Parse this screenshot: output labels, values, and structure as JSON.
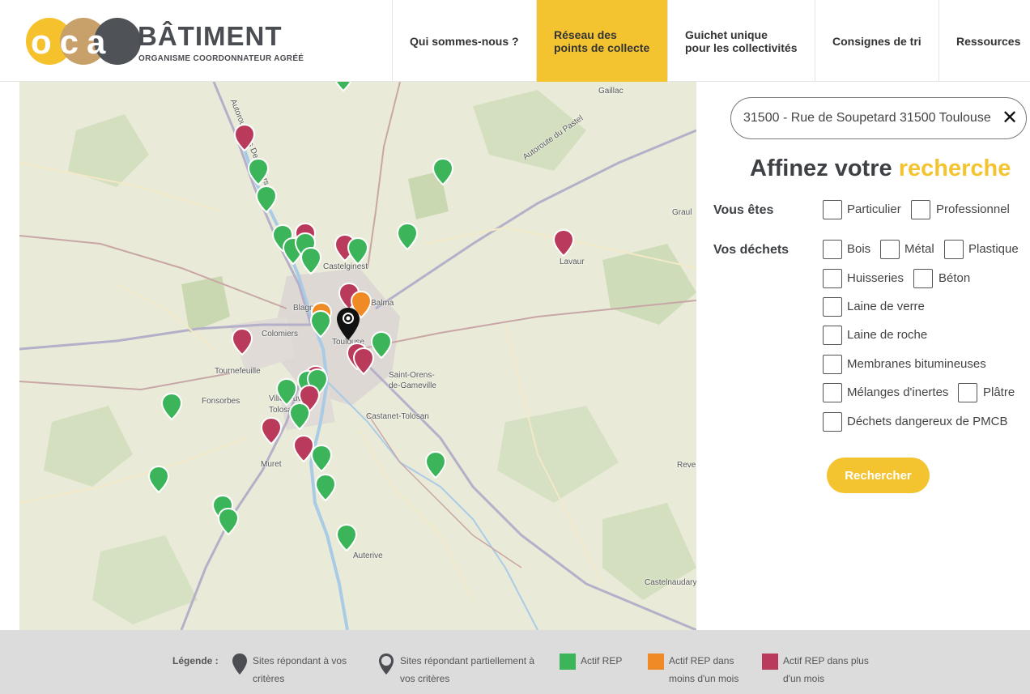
{
  "logo": {
    "letters": "oca",
    "brand": "BÂTIMENT",
    "tagline": "ORGANISME COORDONNATEUR AGRÉÉ"
  },
  "nav": {
    "items": [
      {
        "line1": "Qui sommes-nous ?",
        "line2": ""
      },
      {
        "line1": "Réseau des",
        "line2": "points de collecte"
      },
      {
        "line1": "Guichet unique",
        "line2": "pour les collectivités"
      },
      {
        "line1": "Consignes de tri",
        "line2": ""
      },
      {
        "line1": "Ressources",
        "line2": ""
      }
    ]
  },
  "map": {
    "places": [
      "Gaillac",
      "Autoroute des Deux Mers",
      "Autoroute du Pastel",
      "Graul",
      "Lavaur",
      "Castelginest",
      "Blagnac",
      "Balma",
      "Colomiers",
      "Toulouse",
      "Tournefeuille",
      "Saint-Orens-",
      "de-Gameville",
      "Fonsorbes",
      "Villeneuve-",
      "Tolosane",
      "Castanet-Tolosan",
      "Muret",
      "Auterive",
      "Revel",
      "Castelnaudary"
    ],
    "colors": {
      "green": "#3cb55a",
      "red": "#b93a5a",
      "orange": "#f08a24",
      "black": "#111111"
    }
  },
  "search": {
    "value": "31500 - Rue de Soupetard 31500 Toulouse",
    "clear_icon": "close-icon"
  },
  "refine": {
    "title_prefix": "Affinez votre",
    "title_highlight": "recherche"
  },
  "filters": {
    "vous_etes_label": "Vous êtes",
    "vous_etes": [
      "Particulier",
      "Professionnel"
    ],
    "dechets_label": "Vos déchets",
    "dechets": [
      "Bois",
      "Métal",
      "Plastique",
      "Huisseries",
      "Béton",
      "Laine de verre",
      "Laine de roche",
      "Membranes bitumineuses",
      "Mélanges d'inertes",
      "Plâtre",
      "Déchets dangereux de PMCB"
    ]
  },
  "button": {
    "search": "Rechercher"
  },
  "legend": {
    "title": "Légende :",
    "full_1": "Sites répondant à vos",
    "full_2": "critères",
    "partial_1": "Sites répondant partiellement à",
    "partial_2": "vos critères",
    "green": "Actif REP",
    "orange_1": "Actif REP dans",
    "orange_2": "moins d'un mois",
    "red_1": "Actif REP dans plus",
    "red_2": "d'un mois"
  }
}
